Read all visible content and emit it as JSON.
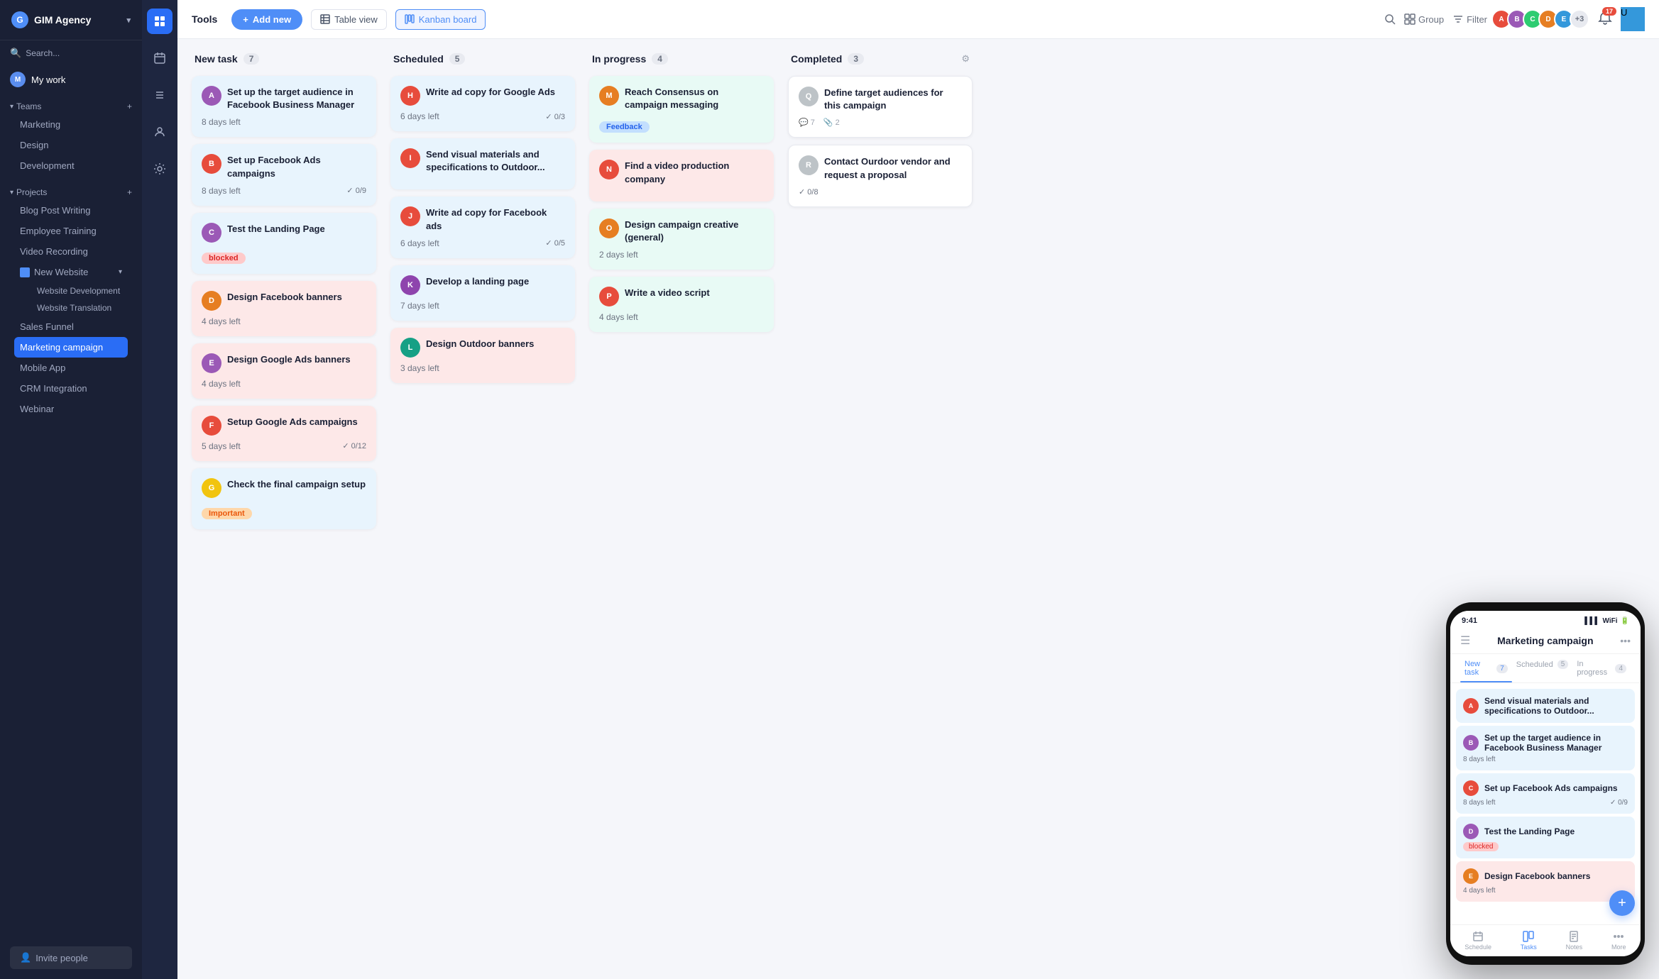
{
  "app": {
    "name": "GIM Agency",
    "logo_letter": "G"
  },
  "sidebar": {
    "search_placeholder": "Search...",
    "my_work_label": "My work",
    "teams_label": "Teams",
    "projects_label": "Projects",
    "teams": [
      "Marketing",
      "Design",
      "Development"
    ],
    "projects": [
      {
        "label": "Blog Post Writing",
        "icon": "doc"
      },
      {
        "label": "Employee Training",
        "icon": "doc"
      },
      {
        "label": "Video Recording",
        "icon": "doc"
      },
      {
        "label": "New Website",
        "icon": "folder",
        "expanded": true,
        "children": [
          "Website Development",
          "Website Translation"
        ]
      },
      {
        "label": "Sales Funnel",
        "icon": "doc"
      },
      {
        "label": "Marketing campaign",
        "icon": "doc",
        "active": true
      },
      {
        "label": "Mobile App",
        "icon": "doc"
      },
      {
        "label": "CRM Integration",
        "icon": "doc"
      },
      {
        "label": "Webinar",
        "icon": "doc"
      }
    ],
    "invite_label": "Invite people"
  },
  "toolbar": {
    "section_label": "Tools",
    "add_new_label": "+ Add new",
    "table_view_label": "Table view",
    "kanban_board_label": "Kanban board",
    "search_placeholder": "Search",
    "group_label": "Group",
    "filter_label": "Filter",
    "extra_avatars_label": "+3"
  },
  "columns": [
    {
      "id": "new-task",
      "title": "New task",
      "count": 7,
      "cards": [
        {
          "id": "card-1",
          "title": "Set up the target audience in Facebook Business Manager",
          "color": "blue",
          "days": "8 days left",
          "avatar_color": "#9b59b6",
          "avatar_letter": "A",
          "badge": null,
          "check": null,
          "comments": null
        },
        {
          "id": "card-2",
          "title": "Set up Facebook Ads campaigns",
          "color": "blue",
          "days": "8 days left",
          "avatar_color": "#e74c3c",
          "avatar_letter": "B",
          "badge": null,
          "check": "0/9",
          "comments": null
        },
        {
          "id": "card-3",
          "title": "Test the Landing Page",
          "color": "blue",
          "days": null,
          "avatar_color": "#9b59b6",
          "avatar_letter": "C",
          "badge": "blocked",
          "badge_type": "red",
          "check": null,
          "comments": null
        },
        {
          "id": "card-4",
          "title": "Design Facebook banners",
          "color": "pink",
          "days": "4 days left",
          "avatar_color": "#e67e22",
          "avatar_letter": "D",
          "badge": null,
          "check": null,
          "comments": null
        },
        {
          "id": "card-5",
          "title": "Design Google Ads banners",
          "color": "pink",
          "days": "4 days left",
          "avatar_color": "#9b59b6",
          "avatar_letter": "E",
          "badge": null,
          "check": null,
          "comments": null
        },
        {
          "id": "card-6",
          "title": "Setup Google Ads campaigns",
          "color": "pink",
          "days": "5 days left",
          "avatar_color": "#e74c3c",
          "avatar_letter": "F",
          "badge": null,
          "check": "0/12",
          "comments": null
        },
        {
          "id": "card-7",
          "title": "Check the final campaign setup",
          "color": "blue",
          "days": null,
          "avatar_color": "#f1c40f",
          "avatar_letter": "G",
          "badge": "Important",
          "badge_type": "orange",
          "check": null,
          "comments": null
        }
      ]
    },
    {
      "id": "scheduled",
      "title": "Scheduled",
      "count": 5,
      "cards": [
        {
          "id": "s-card-1",
          "title": "Write ad copy for Google Ads",
          "color": "blue",
          "days": "6 days left",
          "avatar_color": "#e74c3c",
          "avatar_letter": "H",
          "badge": null,
          "check": "0/3",
          "comments": null
        },
        {
          "id": "s-card-2",
          "title": "Send visual materials and specifications to Outdoor...",
          "color": "blue",
          "days": null,
          "avatar_color": "#e74c3c",
          "avatar_letter": "I",
          "badge": null,
          "check": null,
          "comments": null
        },
        {
          "id": "s-card-3",
          "title": "Write ad copy for Facebook ads",
          "color": "blue",
          "days": "6 days left",
          "avatar_color": "#e74c3c",
          "avatar_letter": "J",
          "badge": null,
          "check": "0/5",
          "comments": null
        },
        {
          "id": "s-card-4",
          "title": "Develop a landing page",
          "color": "blue",
          "days": "7 days left",
          "avatar_color": "#8e44ad",
          "avatar_letter": "K",
          "badge": null,
          "check": null,
          "comments": null
        },
        {
          "id": "s-card-5",
          "title": "Design Outdoor banners",
          "color": "pink",
          "days": "3 days left",
          "avatar_color": "#16a085",
          "avatar_letter": "L",
          "badge": null,
          "check": null,
          "comments": null
        }
      ]
    },
    {
      "id": "in-progress",
      "title": "In progress",
      "count": 4,
      "cards": [
        {
          "id": "p-card-1",
          "title": "Reach Consensus on campaign messaging",
          "color": "teal",
          "days": null,
          "avatar_color": "#e67e22",
          "avatar_letter": "M",
          "badge": "Feedback",
          "badge_type": "blue",
          "check": null,
          "comments": null
        },
        {
          "id": "p-card-2",
          "title": "Find a video production company",
          "color": "pink",
          "days": null,
          "avatar_color": "#e74c3c",
          "avatar_letter": "N",
          "badge": null,
          "check": null,
          "comments": null
        },
        {
          "id": "p-card-3",
          "title": "Design campaign creative (general)",
          "color": "teal",
          "days": "2 days left",
          "avatar_color": "#e67e22",
          "avatar_letter": "O",
          "badge": null,
          "check": null,
          "comments": null
        },
        {
          "id": "p-card-4",
          "title": "Write a video script",
          "color": "teal",
          "days": "4 days left",
          "avatar_color": "#e74c3c",
          "avatar_letter": "P",
          "badge": null,
          "check": null,
          "comments": null
        }
      ]
    },
    {
      "id": "completed",
      "title": "Completed",
      "count": 3,
      "cards": [
        {
          "id": "c-card-1",
          "title": "Define target audiences for this campaign",
          "color": "white",
          "days": null,
          "avatar_color": "#bdc3c7",
          "avatar_letter": "Q",
          "badge": null,
          "check": null,
          "comments_count": "7",
          "attachments": "2"
        },
        {
          "id": "c-card-2",
          "title": "Contact Ourdoor vendor and request a proposal",
          "color": "white",
          "days": null,
          "avatar_color": "#bdc3c7",
          "avatar_letter": "R",
          "badge": null,
          "check": "0/8",
          "comments": null
        }
      ]
    }
  ],
  "phone": {
    "time": "9:41",
    "title": "Marketing campaign",
    "tabs": [
      "New task",
      "Scheduled",
      "In progress"
    ],
    "tab_counts": [
      7,
      5,
      4
    ],
    "cards": [
      {
        "title": "Send visual materials and specifications to Outdoor...",
        "color": "blue",
        "avatar_color": "#e74c3c",
        "days": null
      },
      {
        "title": "Set up the target audience in Facebook Business Manager",
        "color": "blue",
        "avatar_color": "#9b59b6",
        "days": "8 days left"
      },
      {
        "title": "Set up Facebook Ads campaigns",
        "color": "blue",
        "avatar_color": "#e74c3c",
        "days": "8 days left",
        "check": "✓ 0/9"
      },
      {
        "title": "Test the Landing Page",
        "color": "blue",
        "avatar_color": "#9b59b6",
        "days": null,
        "badge": "blocked"
      },
      {
        "title": "Design Facebook banners",
        "color": "pink",
        "avatar_color": "#e67e22",
        "days": "4 days left"
      }
    ],
    "nav_items": [
      "Schedule",
      "Tasks",
      "Notes",
      "More"
    ]
  }
}
